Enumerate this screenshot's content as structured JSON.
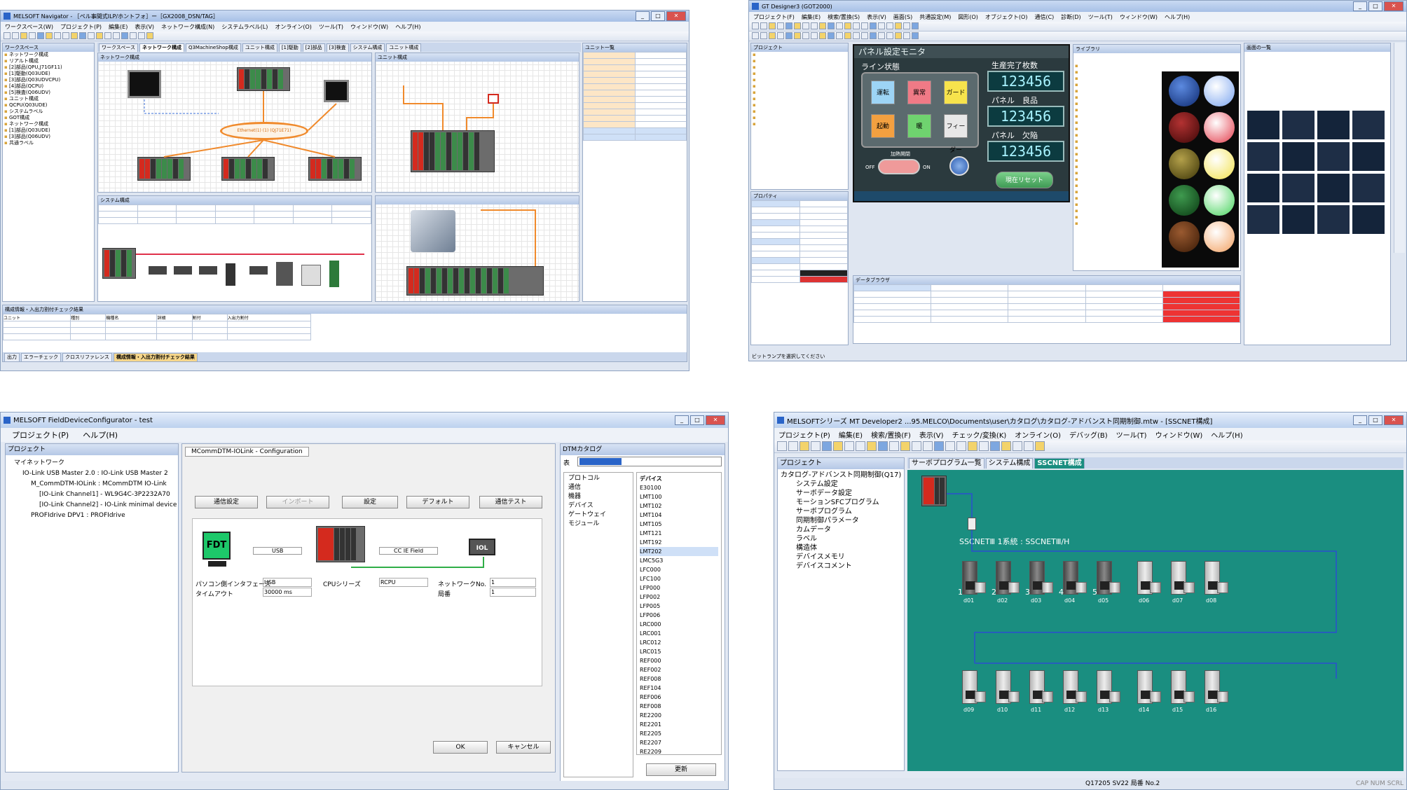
{
  "navigator": {
    "title": "MELSOFT Navigator - ［ペル事間式ILP/ホントフォ］ー［GX2008_DSN/TAG］",
    "menu": [
      "ワークスペース(W)",
      "プロジェクト(P)",
      "編集(E)",
      "表示(V)",
      "ネットワーク構成(N)",
      "システムラベル(L)",
      "オンライン(O)",
      "ツール(T)",
      "ウィンドウ(W)",
      "ヘルプ(H)"
    ],
    "workspace_header": "ワークスペース",
    "tree": [
      "ネットワーク構成",
      "リアルト構成",
      "[2]部品(QPU,J71GF11)",
      "[1]駆動(Q03UDE)",
      "[3]部品(Q03UDVCPU)",
      "[4]部品(QCPU)",
      "[5]検査(Q06UDV)",
      "ユニット構成",
      "QCPU(Q03UDE)",
      "システムラベル",
      "GOT構成",
      "ネットワーク構成",
      "[1]部品(Q03UDE)",
      "[3]部品(Q06UDV)",
      "共通ラベル"
    ],
    "doc_tabs": [
      "ワークスペース",
      "ネットワーク構成",
      "Q3MachineShop構成",
      "ユニット構成",
      "[1]駆動",
      "[2]部品",
      "[3]検査",
      "システム構成",
      "ユニット構成"
    ],
    "network_panel": "ネットワーク構成",
    "ethernet_label": "Ethernet(1) (1) (QJ71E71)",
    "unit_panel": "ユニット構成",
    "system_panel": "システム構成",
    "right_header": "ユニット一覧",
    "bottom_header": "構成情報・入出力割付チェック結果",
    "bottom_tabs": [
      "出力",
      "エラーチェック",
      "クロスリファレンス",
      "構成情報・入出力割付チェック結果"
    ],
    "table_headers": [
      "ユニット",
      "種別",
      "機種名",
      "詳細",
      "割付",
      "入出力割付"
    ]
  },
  "gtdesigner": {
    "title": "GT Designer3 (GOT2000)",
    "menu": [
      "プロジェクト(F)",
      "編集(E)",
      "検索/置換(S)",
      "表示(V)",
      "画面(S)",
      "共通設定(M)",
      "図形(O)",
      "オブジェクト(O)",
      "通信(C)",
      "診断(D)",
      "ツール(T)",
      "ウィンドウ(W)",
      "ヘルプ(H)"
    ],
    "screen_title": "パネル設定モニタ",
    "line_status": "ライン状態",
    "counter1_label": "生産完了枚数",
    "counter2_label": "パネル　良品",
    "counter3_label": "パネル　欠陥",
    "counter_value": "123456",
    "buttons": [
      "運転",
      "異常",
      "ガード",
      "起動",
      "暖",
      "フィーダー"
    ],
    "switch_label": "加熱開閉",
    "reset_label": "現在リセット",
    "off": "OFF",
    "on": "ON",
    "library_header": "ライブラリ",
    "data_header": "データブラウザ",
    "property_header": "プロパティ",
    "preview_header": "画面の一覧",
    "status_text": "ビットランプを選択してください"
  },
  "fdc": {
    "title": "MELSOFT FieldDeviceConfigurator - test",
    "menu": [
      "プロジェクト(P)",
      "ヘルプ(H)"
    ],
    "project_header": "プロジェクト",
    "tree": [
      "マイネットワーク",
      "IO-Link USB Master 2.0 : IO-Link USB Master 2",
      "M_CommDTM-IOLink : MCommDTM IO-Link",
      "[IO-Link Channel1] - WL9G4C-3P2232A70",
      "[IO-Link Channel2] - IO-Link minimal device",
      "PROFIdrive DPV1 : PROFIdrive"
    ],
    "tab": "MCommDTM-IOLink - Configuration",
    "toolbar": [
      "通信設定",
      "インポート",
      "設定",
      "デフォルト",
      "通信テスト"
    ],
    "fdt": "FDT",
    "usb_label": "USB",
    "cc_label": "CC IE Field",
    "iol": "IOL",
    "fields": {
      "if_label": "パソコン側インタフェース",
      "if_value": "USB",
      "timeout_label": "タイムアウト",
      "timeout_value": "30000 ms",
      "cpu_label": "CPUシリーズ",
      "cpu_value": "RCPU",
      "network_label": "ネットワークNo.",
      "network_value": "1",
      "station_label": "局番",
      "station_value": "1"
    },
    "ok": "OK",
    "cancel": "キャンセル",
    "catalog_header": "DTMカタログ",
    "filter_label": "表",
    "categories": [
      "プロトコル",
      "通信",
      "機器",
      "デバイス",
      "ゲートウェイ",
      "モジュール"
    ],
    "device_header": "デバイス",
    "devices": [
      "E30100",
      "LMT100",
      "LMT102",
      "LMT104",
      "LMT105",
      "LMT121",
      "LMT192",
      "LMT202",
      "LMC5G3",
      "LFC000",
      "LFC100",
      "LFP000",
      "LFP002",
      "LFP005",
      "LFP006",
      "LRC000",
      "LRC001",
      "LRC012",
      "LRC015",
      "REF000",
      "REF002",
      "REF008",
      "REF104",
      "REF006",
      "REF008",
      "RE2200",
      "RE2201",
      "RE2205",
      "RE2207",
      "RE2209"
    ],
    "update": "更新"
  },
  "mt": {
    "title": "MELSOFTシリーズ MT Developer2 ...95.MELCO\\Documents\\user\\カタログ\\カタログ-アドバンスト同期制御.mtw - [SSCNET構成]",
    "menu": [
      "プロジェクト(P)",
      "編集(E)",
      "検索/置換(F)",
      "表示(V)",
      "チェック/変換(K)",
      "オンライン(O)",
      "デバッグ(B)",
      "ツール(T)",
      "ウィンドウ(W)",
      "ヘルプ(H)"
    ],
    "project_header": "プロジェクト",
    "tree": [
      "カタログ-アドバンスト同期制御(Q17)",
      "システム設定",
      "サーボデータ設定",
      "モーションSFCプログラム",
      "サーボプログラム",
      "同期制御パラメータ",
      "カムデータ",
      "ラベル",
      "構造体",
      "デバイスメモリ",
      "デバイスコメント"
    ],
    "tabs": [
      "サーボプログラム一覧",
      "システム構成",
      "SSCNET構成"
    ],
    "line_label": "SSCNETⅢ 1系統 : SSCNETⅢ/H",
    "axis_numbers": [
      "1",
      "2",
      "3",
      "4",
      "5"
    ],
    "row1_labels": [
      "d01",
      "d02",
      "d03",
      "d04",
      "d05",
      "d06",
      "d07",
      "d08"
    ],
    "row2_labels": [
      "d09",
      "d10",
      "d11",
      "d12",
      "d13",
      "d14",
      "d15",
      "d16"
    ],
    "status": "Q17205  SV22  局番 No.2",
    "status_right": "CAP NUM SCRL"
  },
  "colors": {
    "teal_canvas": "#1a8e80",
    "sscnet_line": "#2a4fd0",
    "cc_link": "#2fae47",
    "title_bar": "#bcd1ee"
  }
}
